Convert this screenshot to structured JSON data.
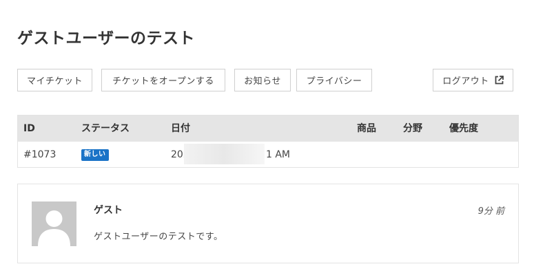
{
  "page": {
    "title": "ゲストユーザーのテスト"
  },
  "nav": {
    "my_tickets": "マイチケット",
    "open_ticket": "チケットをオープンする",
    "notices": "お知らせ",
    "privacy": "プライバシー",
    "logout": "ログアウト",
    "logout_icon": "external-link-icon"
  },
  "table": {
    "headers": {
      "id": "ID",
      "status": "ステータス",
      "date": "日付",
      "product": "商品",
      "category": "分野",
      "priority": "優先度"
    },
    "rows": [
      {
        "id": "#1073",
        "status": "新しい",
        "date_prefix": "202",
        "date_suffix": "1 AM",
        "product": "",
        "category": "",
        "priority": ""
      }
    ]
  },
  "reply": {
    "author": "ゲスト",
    "time_ago": "9分 前",
    "message": "ゲストユーザーのテストです。",
    "avatar_icon": "user-silhouette-icon"
  },
  "colors": {
    "badge_new": "#1a73c7",
    "table_header_bg": "#e5e5e5",
    "avatar_bg": "#c8c8c8"
  }
}
